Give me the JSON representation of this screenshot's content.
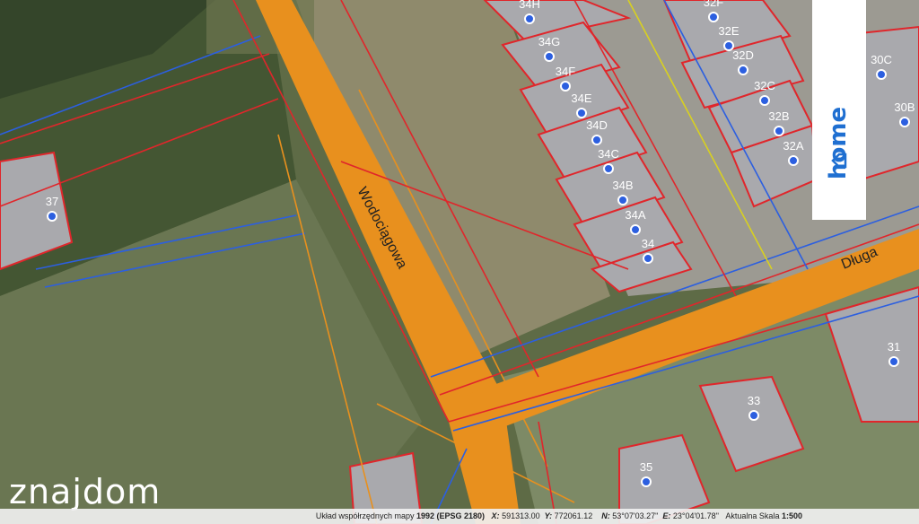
{
  "map": {
    "streets": [
      "Wodociągowa",
      "Długa"
    ],
    "parcels": [
      {
        "label": "34H"
      },
      {
        "label": "34G"
      },
      {
        "label": "34F"
      },
      {
        "label": "34E"
      },
      {
        "label": "34D"
      },
      {
        "label": "34C"
      },
      {
        "label": "34B"
      },
      {
        "label": "34A"
      },
      {
        "label": "34"
      },
      {
        "label": "32F"
      },
      {
        "label": "32E"
      },
      {
        "label": "32D"
      },
      {
        "label": "32C"
      },
      {
        "label": "32B"
      },
      {
        "label": "32A"
      },
      {
        "label": "30C"
      },
      {
        "label": "30B"
      },
      {
        "label": "37"
      },
      {
        "label": "33"
      },
      {
        "label": "31"
      },
      {
        "label": "35"
      }
    ]
  },
  "badge": {
    "text": "home"
  },
  "brand": {
    "logo_text": "znajdom"
  },
  "status_bar": {
    "system_label": "Układ współrzędnych mapy",
    "system_value": "1992 (EPSG 2180)",
    "x_label": "X:",
    "x_value": "591313.00",
    "y_label": "Y:",
    "y_value": "772061.12",
    "n_label": "N:",
    "n_value": "53°07'03.27\"",
    "e_label": "E:",
    "e_value": "23°04'01.78\"",
    "scale_label": "Aktualna Skala",
    "scale_value": "1:500"
  },
  "colors": {
    "road": "#e8901e",
    "parcel_line": "#e0262b",
    "marker": "#2c5fe0",
    "accent": "#1f6fd1"
  }
}
